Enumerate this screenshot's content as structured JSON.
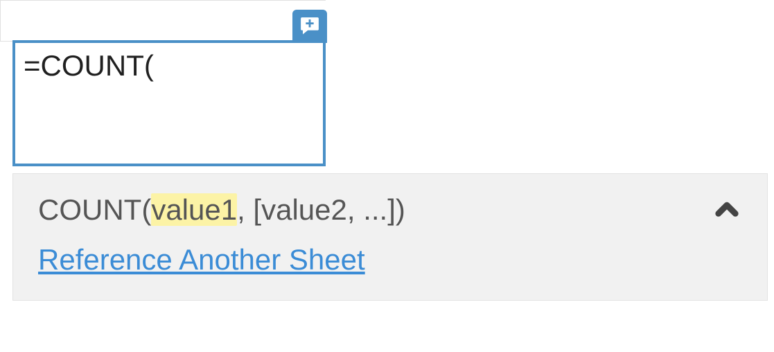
{
  "cell": {
    "formula_value": "=COUNT("
  },
  "tooltip": {
    "signature_prefix": "COUNT(",
    "signature_highlight": "value1",
    "signature_suffix": ", [value2, ...])",
    "link_label": "Reference Another Sheet"
  },
  "icons": {
    "comment": "comment-plus-icon",
    "caret": "chevron-up-icon"
  }
}
